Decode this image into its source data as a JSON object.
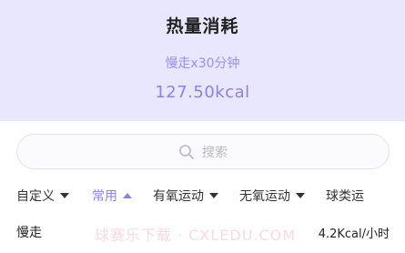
{
  "header": {
    "title": "热量消耗",
    "subtitle": "慢走x30分钟",
    "calories": "127.50kcal"
  },
  "search": {
    "placeholder": "搜索",
    "icon": "search-icon"
  },
  "tabs": [
    {
      "label": "自定义",
      "active": false
    },
    {
      "label": "常用",
      "active": true
    },
    {
      "label": "有氧运动",
      "active": false
    },
    {
      "label": "无氧运动",
      "active": false
    },
    {
      "label": "球类运"
    }
  ],
  "list": [
    {
      "name": "慢走",
      "value": "4.2Kcal/小时"
    }
  ],
  "watermark": "球赛乐下载 · CXLEDU.COM",
  "colors": {
    "header_bg": "#e9e7fd",
    "accent": "#8d7ff0"
  }
}
